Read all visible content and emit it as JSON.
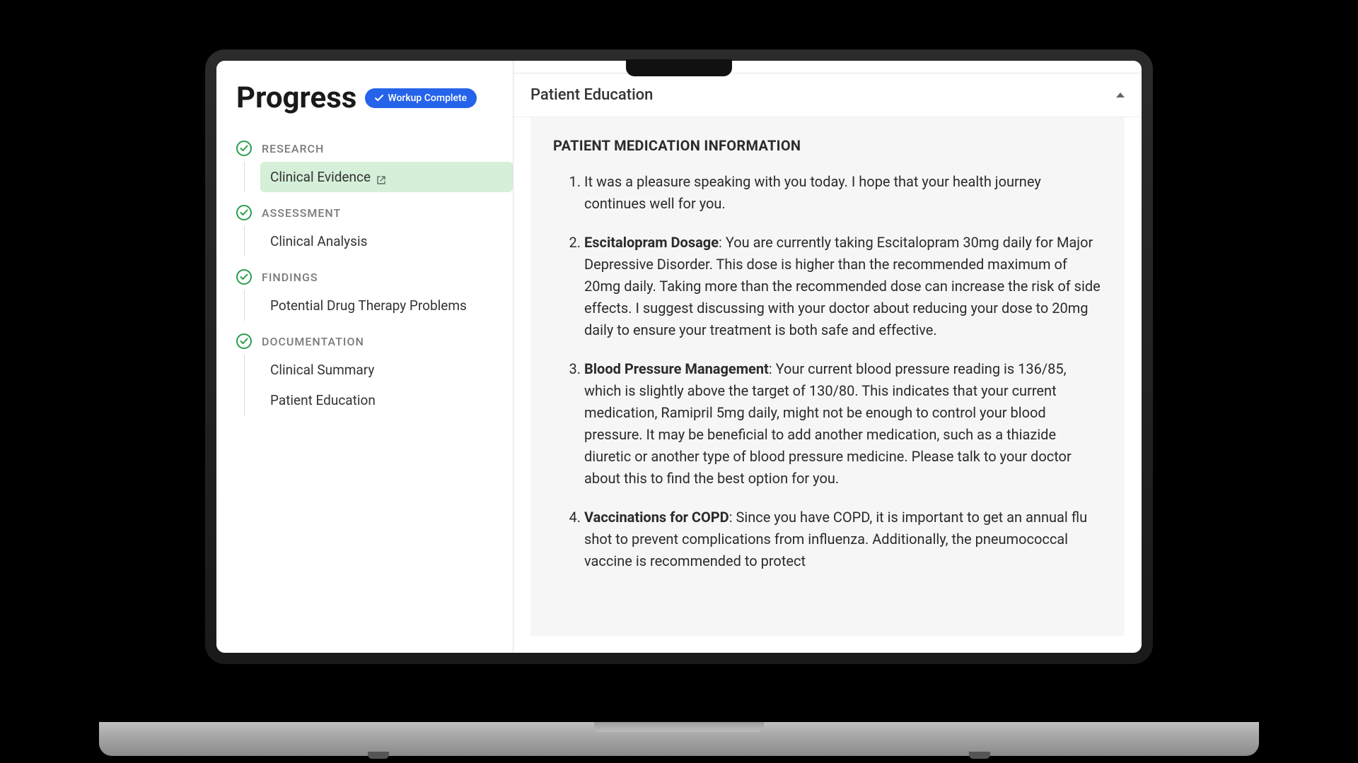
{
  "sidebar": {
    "title": "Progress",
    "badge": "Workup Complete",
    "groups": [
      {
        "label": "RESEARCH",
        "items": [
          {
            "label": "Clinical Evidence",
            "external": true,
            "active": true
          }
        ]
      },
      {
        "label": "ASSESSMENT",
        "items": [
          {
            "label": "Clinical Analysis"
          }
        ]
      },
      {
        "label": "FINDINGS",
        "items": [
          {
            "label": "Potential Drug Therapy Problems"
          }
        ]
      },
      {
        "label": "DOCUMENTATION",
        "items": [
          {
            "label": "Clinical Summary"
          },
          {
            "label": "Patient Education"
          }
        ]
      }
    ]
  },
  "main": {
    "section_title": "Patient Education",
    "heading": "PATIENT MEDICATION INFORMATION",
    "items": [
      {
        "lead": "",
        "text": "It was a pleasure speaking with you today. I hope that your health journey continues well for you."
      },
      {
        "lead": "Escitalopram Dosage",
        "text": ": You are currently taking Escitalopram 30mg daily for Major Depressive Disorder. This dose is higher than the recommended maximum of 20mg daily. Taking more than the recommended dose can increase the risk of side effects. I suggest discussing with your doctor about reducing your dose to 20mg daily to ensure your treatment is both safe and effective."
      },
      {
        "lead": "Blood Pressure Management",
        "text": ": Your current blood pressure reading is 136/85, which is slightly above the target of 130/80. This indicates that your current medication, Ramipril 5mg daily, might not be enough to control your blood pressure. It may be beneficial to add another medication, such as a thiazide diuretic or another type of blood pressure medicine. Please talk to your doctor about this to find the best option for you."
      },
      {
        "lead": "Vaccinations for COPD",
        "text": ": Since you have COPD, it is important to get an annual flu shot to prevent complications from influenza. Additionally, the pneumococcal vaccine is recommended to protect"
      }
    ]
  }
}
